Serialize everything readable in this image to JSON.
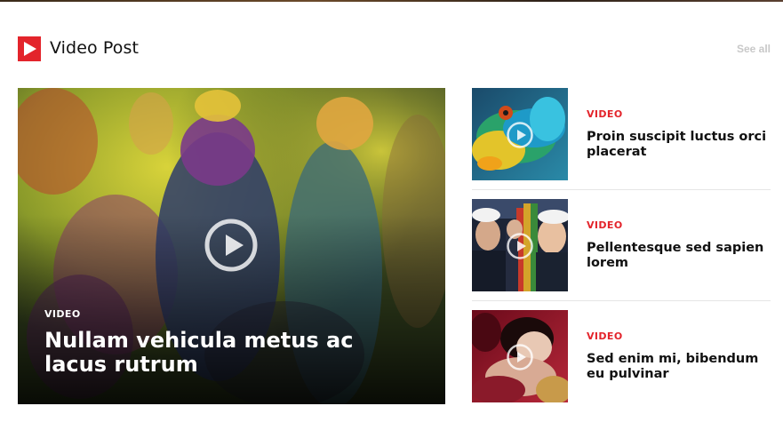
{
  "section": {
    "title": "Video Post",
    "see_all": "See all",
    "icon": "play-square-icon",
    "accent_color": "#e3242b"
  },
  "featured": {
    "tag": "VIDEO",
    "title": "Nullam vehicula metus ac lacus rutrum",
    "icon": "play-circle-icon"
  },
  "side_posts": [
    {
      "tag": "VIDEO",
      "title": "Proin suscipit luctus orci placerat",
      "icon": "play-circle-icon"
    },
    {
      "tag": "VIDEO",
      "title": "Pellentesque sed sapien lorem",
      "icon": "play-circle-icon"
    },
    {
      "tag": "VIDEO",
      "title": "Sed enim mi, bibendum eu pulvinar",
      "icon": "play-circle-icon"
    }
  ]
}
